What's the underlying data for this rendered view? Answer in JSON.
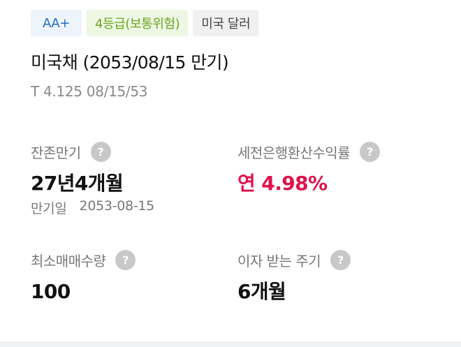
{
  "badges": {
    "credit_rating": "AA+",
    "risk_grade": "4등급(보통위험)",
    "currency": "미국 달러"
  },
  "bond": {
    "name": "미국채 (2053/08/15 만기)",
    "code": "T 4.125 08/15/53"
  },
  "info": {
    "remaining_maturity": {
      "label": "잔존만기",
      "value": "27년4개월",
      "sub_label": "만기일",
      "sub_value": "2053-08-15"
    },
    "pre_tax_yield": {
      "label": "세전은행환산수익률",
      "value": "연 4.98%"
    },
    "min_purchase_qty": {
      "label": "최소매매수량",
      "value": "100"
    },
    "interest_cycle": {
      "label": "이자 받는 주기",
      "value": "6개월"
    }
  },
  "help_icon_glyph": "?",
  "colors": {
    "credit_badge_text": "#1f6dc4",
    "credit_badge_bg": "#eef4fb",
    "risk_badge_text": "#6aa524",
    "risk_badge_bg": "#eef7e3",
    "yield_value": "#e0134a",
    "help_icon_bg": "#c8c8c8"
  }
}
